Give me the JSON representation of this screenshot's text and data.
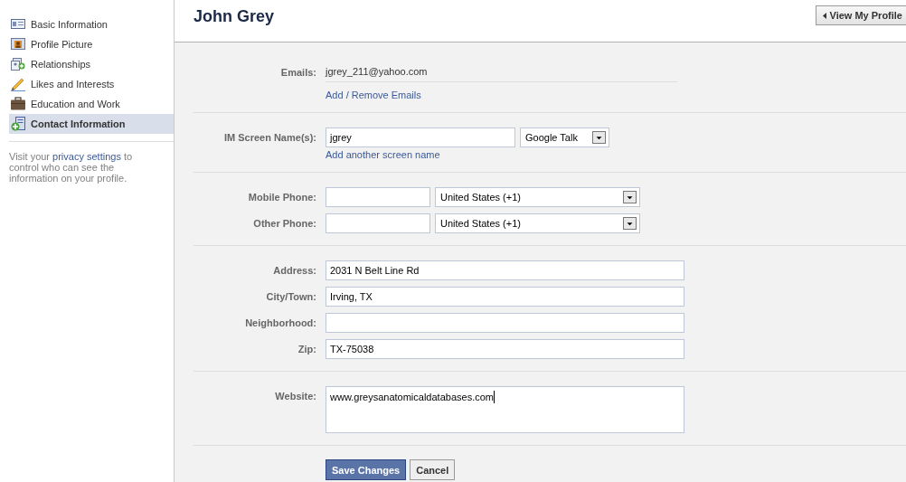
{
  "sidebar": {
    "items": [
      {
        "label": "Basic Information",
        "selected": false
      },
      {
        "label": "Profile Picture",
        "selected": false
      },
      {
        "label": "Relationships",
        "selected": false
      },
      {
        "label": "Likes and Interests",
        "selected": false
      },
      {
        "label": "Education and Work",
        "selected": false
      },
      {
        "label": "Contact Information",
        "selected": true
      }
    ],
    "note": {
      "before": "Visit your ",
      "link": "privacy settings",
      "after": " to control who can see the information on your profile."
    }
  },
  "header": {
    "title": "John Grey",
    "button": "View My Profile"
  },
  "form": {
    "sections": [
      {
        "rows": [
          {
            "kind": "static",
            "label": "Emails:",
            "value": "jgrey_211@yahoo.com"
          }
        ],
        "link": "Add / Remove Emails"
      },
      {
        "rows": [
          {
            "kind": "field-select",
            "label": "IM Screen Name(s):",
            "value": "jgrey",
            "select": "Google Talk",
            "focused": false
          }
        ],
        "link": "Add another screen name"
      },
      {
        "rows": [
          {
            "kind": "phone",
            "label": "Mobile Phone:",
            "select": "United States (+1)",
            "focused": false
          },
          {
            "kind": "phone",
            "label": "Other Phone:",
            "select": "United States (+1)",
            "focused": false
          }
        ]
      },
      {
        "rows": [
          {
            "kind": "field",
            "label": "Address:",
            "value": "2031 N Belt Line Rd",
            "focused": false
          },
          {
            "kind": "field",
            "label": "City/Town:",
            "value": "Irving, TX",
            "focused": false
          },
          {
            "kind": "field",
            "label": "Neighborhood:",
            "focused": false
          },
          {
            "kind": "field",
            "label": "Zip:",
            "value": "TX-75038",
            "focused": false
          }
        ]
      },
      {
        "rows": [
          {
            "kind": "textarea",
            "label": "Website:",
            "value": "www.greysanatomicaldatabases.com",
            "focused": true
          }
        ]
      }
    ],
    "buttons": [
      {
        "label": "Save Changes",
        "kind": "primary"
      },
      {
        "label": "Cancel",
        "kind": "secondary"
      }
    ]
  }
}
